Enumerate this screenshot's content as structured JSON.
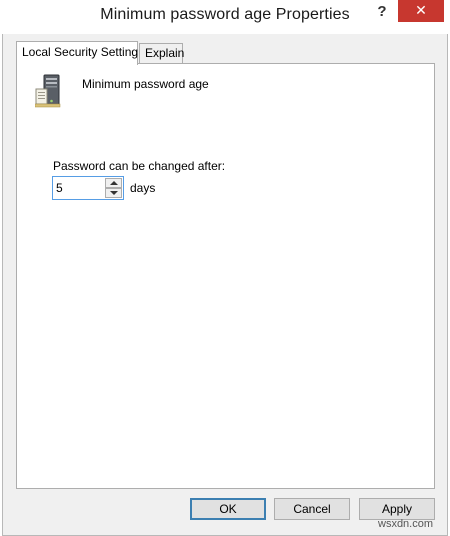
{
  "window": {
    "title": "Minimum password age Properties",
    "help_label": "?",
    "close_label": "✕"
  },
  "tabs": [
    {
      "label": "Local Security Setting",
      "active": true
    },
    {
      "label": "Explain",
      "active": false
    }
  ],
  "policy": {
    "name": "Minimum password age",
    "icon": "server-computer-icon"
  },
  "setting": {
    "label": "Password can be changed after:",
    "value": "5",
    "unit": "days"
  },
  "buttons": {
    "ok": "OK",
    "cancel": "Cancel",
    "apply": "Apply"
  },
  "watermark": "wsxdn.com",
  "colors": {
    "close_button": "#c7372f",
    "focus_border": "#569de5",
    "dialog_bg": "#f0f0f0"
  }
}
